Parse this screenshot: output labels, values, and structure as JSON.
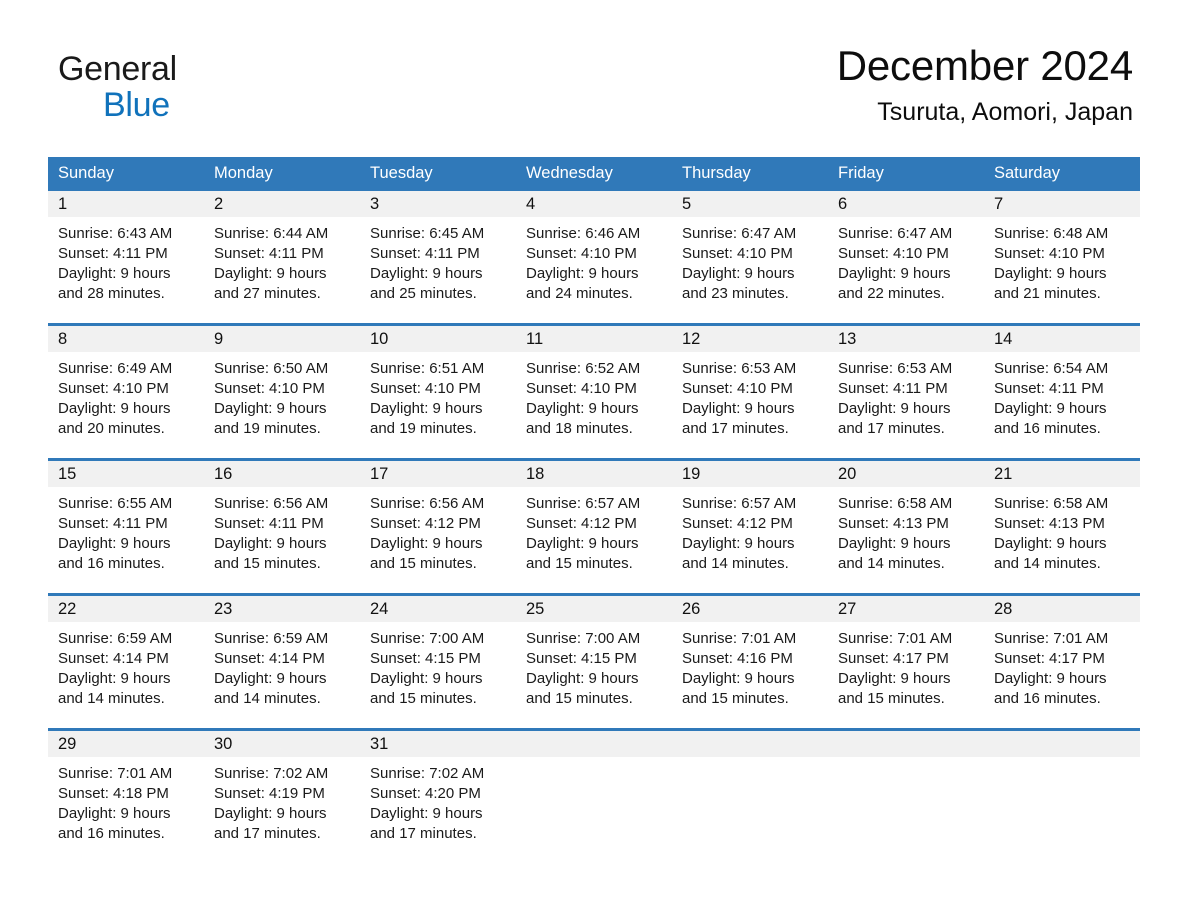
{
  "logo": {
    "word1": "General",
    "word2": "Blue",
    "triangle_color": "#1072bb",
    "word2_color": "#1072bb",
    "word1_color": "#1a1a1a"
  },
  "header": {
    "title": "December 2024",
    "subtitle": "Tsuruta, Aomori, Japan"
  },
  "theme": {
    "accent": "#3079b9",
    "day_band": "#f1f1f1",
    "text": "#1a1a1a"
  },
  "weekday_headers": [
    "Sunday",
    "Monday",
    "Tuesday",
    "Wednesday",
    "Thursday",
    "Friday",
    "Saturday"
  ],
  "weeks": [
    [
      {
        "day": "1",
        "sunrise": "Sunrise: 6:43 AM",
        "sunset": "Sunset: 4:11 PM",
        "daylight_l1": "Daylight: 9 hours",
        "daylight_l2": "and 28 minutes."
      },
      {
        "day": "2",
        "sunrise": "Sunrise: 6:44 AM",
        "sunset": "Sunset: 4:11 PM",
        "daylight_l1": "Daylight: 9 hours",
        "daylight_l2": "and 27 minutes."
      },
      {
        "day": "3",
        "sunrise": "Sunrise: 6:45 AM",
        "sunset": "Sunset: 4:11 PM",
        "daylight_l1": "Daylight: 9 hours",
        "daylight_l2": "and 25 minutes."
      },
      {
        "day": "4",
        "sunrise": "Sunrise: 6:46 AM",
        "sunset": "Sunset: 4:10 PM",
        "daylight_l1": "Daylight: 9 hours",
        "daylight_l2": "and 24 minutes."
      },
      {
        "day": "5",
        "sunrise": "Sunrise: 6:47 AM",
        "sunset": "Sunset: 4:10 PM",
        "daylight_l1": "Daylight: 9 hours",
        "daylight_l2": "and 23 minutes."
      },
      {
        "day": "6",
        "sunrise": "Sunrise: 6:47 AM",
        "sunset": "Sunset: 4:10 PM",
        "daylight_l1": "Daylight: 9 hours",
        "daylight_l2": "and 22 minutes."
      },
      {
        "day": "7",
        "sunrise": "Sunrise: 6:48 AM",
        "sunset": "Sunset: 4:10 PM",
        "daylight_l1": "Daylight: 9 hours",
        "daylight_l2": "and 21 minutes."
      }
    ],
    [
      {
        "day": "8",
        "sunrise": "Sunrise: 6:49 AM",
        "sunset": "Sunset: 4:10 PM",
        "daylight_l1": "Daylight: 9 hours",
        "daylight_l2": "and 20 minutes."
      },
      {
        "day": "9",
        "sunrise": "Sunrise: 6:50 AM",
        "sunset": "Sunset: 4:10 PM",
        "daylight_l1": "Daylight: 9 hours",
        "daylight_l2": "and 19 minutes."
      },
      {
        "day": "10",
        "sunrise": "Sunrise: 6:51 AM",
        "sunset": "Sunset: 4:10 PM",
        "daylight_l1": "Daylight: 9 hours",
        "daylight_l2": "and 19 minutes."
      },
      {
        "day": "11",
        "sunrise": "Sunrise: 6:52 AM",
        "sunset": "Sunset: 4:10 PM",
        "daylight_l1": "Daylight: 9 hours",
        "daylight_l2": "and 18 minutes."
      },
      {
        "day": "12",
        "sunrise": "Sunrise: 6:53 AM",
        "sunset": "Sunset: 4:10 PM",
        "daylight_l1": "Daylight: 9 hours",
        "daylight_l2": "and 17 minutes."
      },
      {
        "day": "13",
        "sunrise": "Sunrise: 6:53 AM",
        "sunset": "Sunset: 4:11 PM",
        "daylight_l1": "Daylight: 9 hours",
        "daylight_l2": "and 17 minutes."
      },
      {
        "day": "14",
        "sunrise": "Sunrise: 6:54 AM",
        "sunset": "Sunset: 4:11 PM",
        "daylight_l1": "Daylight: 9 hours",
        "daylight_l2": "and 16 minutes."
      }
    ],
    [
      {
        "day": "15",
        "sunrise": "Sunrise: 6:55 AM",
        "sunset": "Sunset: 4:11 PM",
        "daylight_l1": "Daylight: 9 hours",
        "daylight_l2": "and 16 minutes."
      },
      {
        "day": "16",
        "sunrise": "Sunrise: 6:56 AM",
        "sunset": "Sunset: 4:11 PM",
        "daylight_l1": "Daylight: 9 hours",
        "daylight_l2": "and 15 minutes."
      },
      {
        "day": "17",
        "sunrise": "Sunrise: 6:56 AM",
        "sunset": "Sunset: 4:12 PM",
        "daylight_l1": "Daylight: 9 hours",
        "daylight_l2": "and 15 minutes."
      },
      {
        "day": "18",
        "sunrise": "Sunrise: 6:57 AM",
        "sunset": "Sunset: 4:12 PM",
        "daylight_l1": "Daylight: 9 hours",
        "daylight_l2": "and 15 minutes."
      },
      {
        "day": "19",
        "sunrise": "Sunrise: 6:57 AM",
        "sunset": "Sunset: 4:12 PM",
        "daylight_l1": "Daylight: 9 hours",
        "daylight_l2": "and 14 minutes."
      },
      {
        "day": "20",
        "sunrise": "Sunrise: 6:58 AM",
        "sunset": "Sunset: 4:13 PM",
        "daylight_l1": "Daylight: 9 hours",
        "daylight_l2": "and 14 minutes."
      },
      {
        "day": "21",
        "sunrise": "Sunrise: 6:58 AM",
        "sunset": "Sunset: 4:13 PM",
        "daylight_l1": "Daylight: 9 hours",
        "daylight_l2": "and 14 minutes."
      }
    ],
    [
      {
        "day": "22",
        "sunrise": "Sunrise: 6:59 AM",
        "sunset": "Sunset: 4:14 PM",
        "daylight_l1": "Daylight: 9 hours",
        "daylight_l2": "and 14 minutes."
      },
      {
        "day": "23",
        "sunrise": "Sunrise: 6:59 AM",
        "sunset": "Sunset: 4:14 PM",
        "daylight_l1": "Daylight: 9 hours",
        "daylight_l2": "and 14 minutes."
      },
      {
        "day": "24",
        "sunrise": "Sunrise: 7:00 AM",
        "sunset": "Sunset: 4:15 PM",
        "daylight_l1": "Daylight: 9 hours",
        "daylight_l2": "and 15 minutes."
      },
      {
        "day": "25",
        "sunrise": "Sunrise: 7:00 AM",
        "sunset": "Sunset: 4:15 PM",
        "daylight_l1": "Daylight: 9 hours",
        "daylight_l2": "and 15 minutes."
      },
      {
        "day": "26",
        "sunrise": "Sunrise: 7:01 AM",
        "sunset": "Sunset: 4:16 PM",
        "daylight_l1": "Daylight: 9 hours",
        "daylight_l2": "and 15 minutes."
      },
      {
        "day": "27",
        "sunrise": "Sunrise: 7:01 AM",
        "sunset": "Sunset: 4:17 PM",
        "daylight_l1": "Daylight: 9 hours",
        "daylight_l2": "and 15 minutes."
      },
      {
        "day": "28",
        "sunrise": "Sunrise: 7:01 AM",
        "sunset": "Sunset: 4:17 PM",
        "daylight_l1": "Daylight: 9 hours",
        "daylight_l2": "and 16 minutes."
      }
    ],
    [
      {
        "day": "29",
        "sunrise": "Sunrise: 7:01 AM",
        "sunset": "Sunset: 4:18 PM",
        "daylight_l1": "Daylight: 9 hours",
        "daylight_l2": "and 16 minutes."
      },
      {
        "day": "30",
        "sunrise": "Sunrise: 7:02 AM",
        "sunset": "Sunset: 4:19 PM",
        "daylight_l1": "Daylight: 9 hours",
        "daylight_l2": "and 17 minutes."
      },
      {
        "day": "31",
        "sunrise": "Sunrise: 7:02 AM",
        "sunset": "Sunset: 4:20 PM",
        "daylight_l1": "Daylight: 9 hours",
        "daylight_l2": "and 17 minutes."
      },
      {
        "day": "",
        "sunrise": "",
        "sunset": "",
        "daylight_l1": "",
        "daylight_l2": ""
      },
      {
        "day": "",
        "sunrise": "",
        "sunset": "",
        "daylight_l1": "",
        "daylight_l2": ""
      },
      {
        "day": "",
        "sunrise": "",
        "sunset": "",
        "daylight_l1": "",
        "daylight_l2": ""
      },
      {
        "day": "",
        "sunrise": "",
        "sunset": "",
        "daylight_l1": "",
        "daylight_l2": ""
      }
    ]
  ]
}
